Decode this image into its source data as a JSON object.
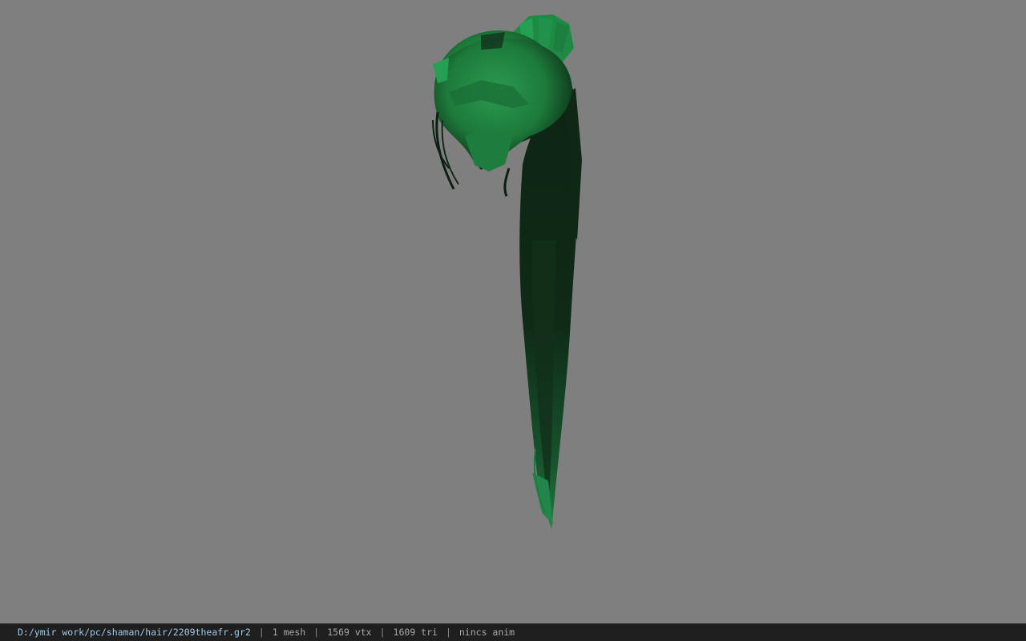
{
  "viewport": {
    "background": "#7f7f7f",
    "model": {
      "name": "hair-mesh",
      "primary_color": "#1f7a3e",
      "shadow_color": "#0a1d10"
    }
  },
  "status_bar": {
    "file_path": "D:/ymir work/pc/shaman/hair/2209theafr.gr2",
    "mesh_count": "1 mesh",
    "vertex_count": "1569 vtx",
    "triangle_count": "1609 tri",
    "anim": "nincs anim",
    "separator": "|"
  }
}
